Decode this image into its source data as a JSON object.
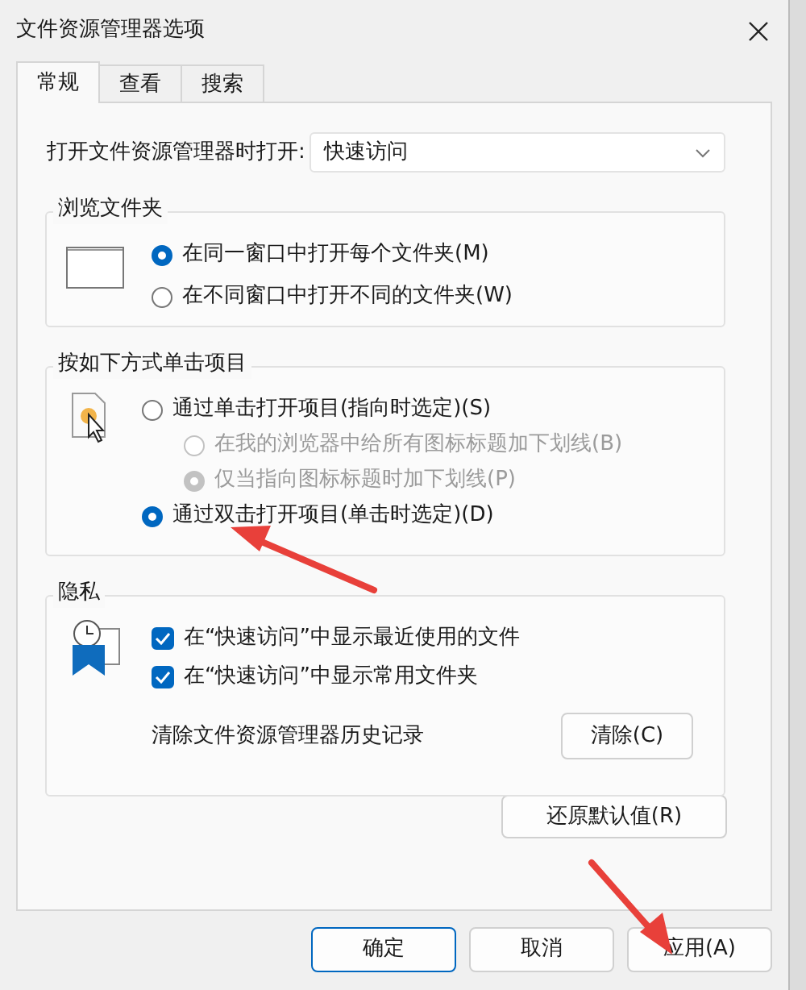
{
  "window": {
    "title": "文件资源管理器选项"
  },
  "tabs": [
    {
      "label": "常规",
      "selected": true
    },
    {
      "label": "查看",
      "selected": false
    },
    {
      "label": "搜索",
      "selected": false
    }
  ],
  "open_with": {
    "label": "打开文件资源管理器时打开:",
    "value": "快速访问"
  },
  "browse_folders": {
    "title": "浏览文件夹",
    "options": [
      {
        "label": "在同一窗口中打开每个文件夹(M)",
        "selected": true
      },
      {
        "label": "在不同窗口中打开不同的文件夹(W)",
        "selected": false
      }
    ]
  },
  "click_items": {
    "title": "按如下方式单击项目",
    "options": [
      {
        "label": "通过单击打开项目(指向时选定)(S)",
        "selected": false,
        "disabled": false,
        "children": [
          {
            "label": "在我的浏览器中给所有图标标题加下划线(B)",
            "selected": false,
            "disabled": true
          },
          {
            "label": "仅当指向图标标题时加下划线(P)",
            "selected": true,
            "disabled": true
          }
        ]
      },
      {
        "label": "通过双击打开项目(单击时选定)(D)",
        "selected": true,
        "disabled": false
      }
    ]
  },
  "privacy": {
    "title": "隐私",
    "checkboxes": [
      {
        "label": "在“快速访问”中显示最近使用的文件",
        "checked": true
      },
      {
        "label": "在“快速访问”中显示常用文件夹",
        "checked": true
      }
    ],
    "clear_label": "清除文件资源管理器历史记录",
    "clear_button": "清除(C)"
  },
  "restore_button": "还原默认值(R)",
  "footer_buttons": [
    {
      "label": "确定",
      "default": true
    },
    {
      "label": "取消",
      "default": false
    },
    {
      "label": "应用(A)",
      "default": false
    }
  ]
}
